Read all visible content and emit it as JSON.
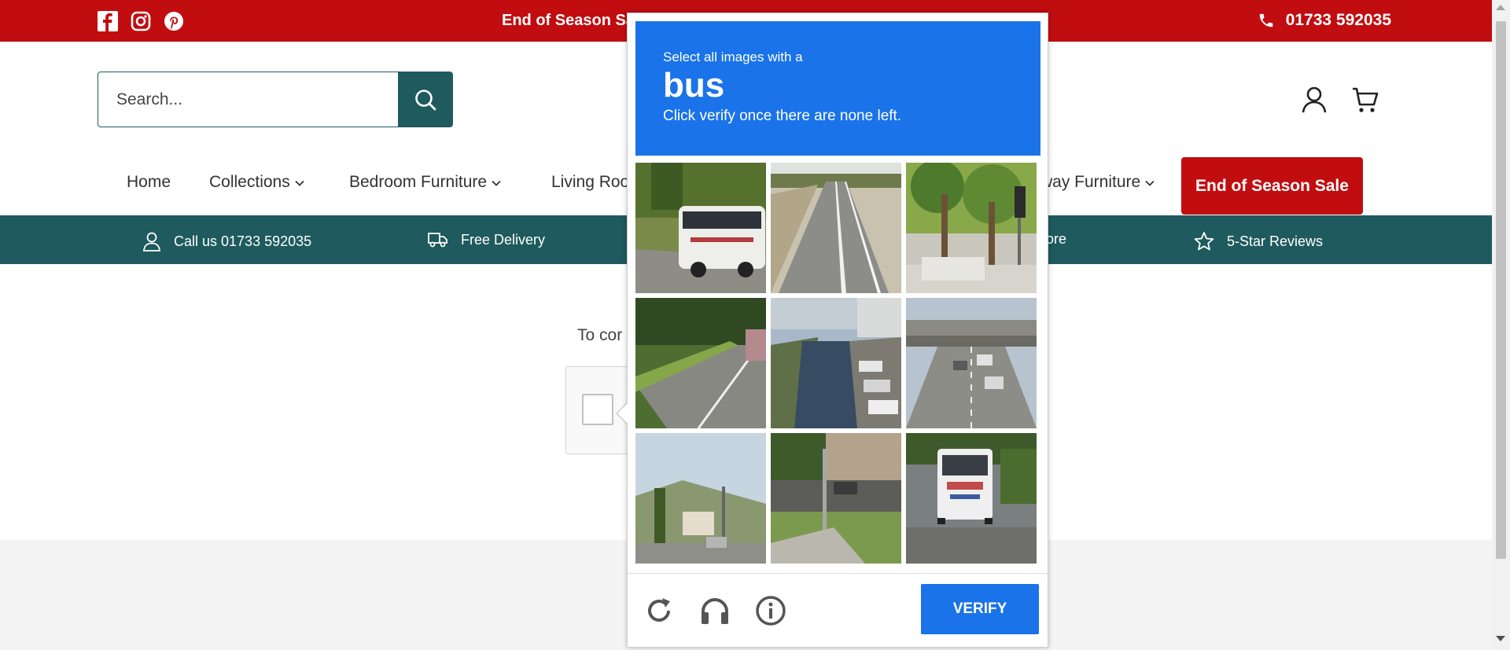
{
  "topbar": {
    "sale_message": "End of Season Sa",
    "phone": "01733 592035",
    "social_icons": [
      "facebook-icon",
      "instagram-icon",
      "pinterest-icon"
    ]
  },
  "header": {
    "search_placeholder": "Search..."
  },
  "nav": {
    "items": [
      {
        "label": "Home",
        "dropdown": false
      },
      {
        "label": "Collections",
        "dropdown": true
      },
      {
        "label": "Bedroom Furniture",
        "dropdown": true
      },
      {
        "label": "Living Roo",
        "dropdown": false
      },
      {
        "label": "way Furniture",
        "dropdown": true
      }
    ],
    "sale_button": "End of Season Sale"
  },
  "usp": {
    "items": [
      {
        "icon": "user-icon",
        "label": "Call us 01733 592035"
      },
      {
        "icon": "truck-icon",
        "label": "Free Delivery"
      },
      {
        "icon": "store-icon",
        "label": "ore"
      },
      {
        "icon": "star-icon",
        "label": "5-Star Reviews"
      }
    ]
  },
  "content": {
    "text": "To cor"
  },
  "challenge": {
    "instruction": "Select all images with a",
    "keyword": "bus",
    "subtext": "Click verify once there are none left.",
    "tiles": [
      "bus on highway",
      "empty highway",
      "palm trees and traffic light",
      "road with grass verge",
      "canal with boats",
      "highway under overpass",
      "street with hills",
      "street with trees",
      "bus on street"
    ],
    "verify_label": "VERIFY",
    "footer_icons": [
      "reload-icon",
      "headphones-icon",
      "info-icon"
    ]
  },
  "colors": {
    "brand_red": "#c10d10",
    "brand_teal": "#1e5a5e",
    "captcha_blue": "#1a73e8"
  }
}
